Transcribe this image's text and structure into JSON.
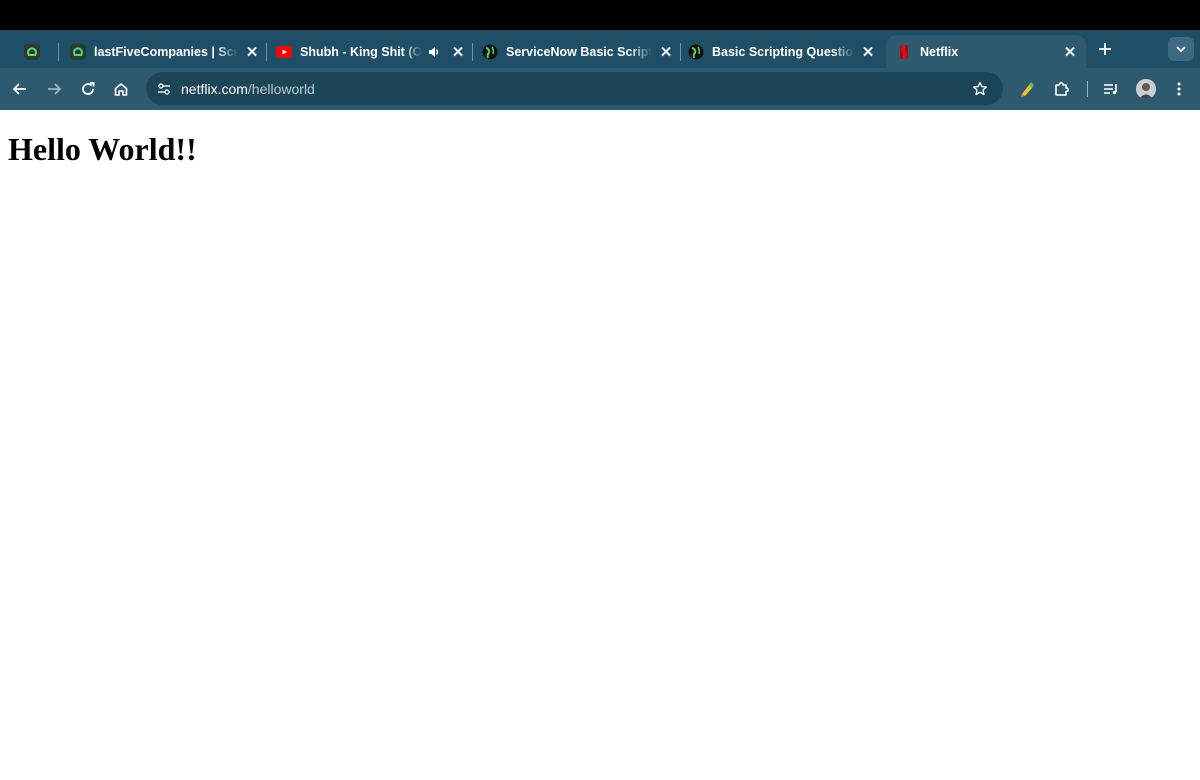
{
  "browser": {
    "tabs": [
      {
        "title": "",
        "icon": "leetcode-icon",
        "pinned": true
      },
      {
        "title": "lastFiveCompanies | Scrip",
        "icon": "leetcode-icon"
      },
      {
        "title": "Shubh - King Shit (Off",
        "icon": "youtube-icon",
        "audio": true
      },
      {
        "title": "ServiceNow Basic Scriptin",
        "icon": "globe-icon"
      },
      {
        "title": "Basic Scripting Questions",
        "icon": "globe-icon"
      },
      {
        "title": "Netflix",
        "icon": "netflix-icon",
        "active": true
      }
    ],
    "address_bar": {
      "host": "netflix.com",
      "path": "/helloworld"
    },
    "accent_colors": {
      "tabstrip": "#1f4f66",
      "toolbar": "#2e5a6f",
      "omnibox": "#1c4558"
    }
  },
  "page": {
    "heading": "Hello World!!"
  }
}
